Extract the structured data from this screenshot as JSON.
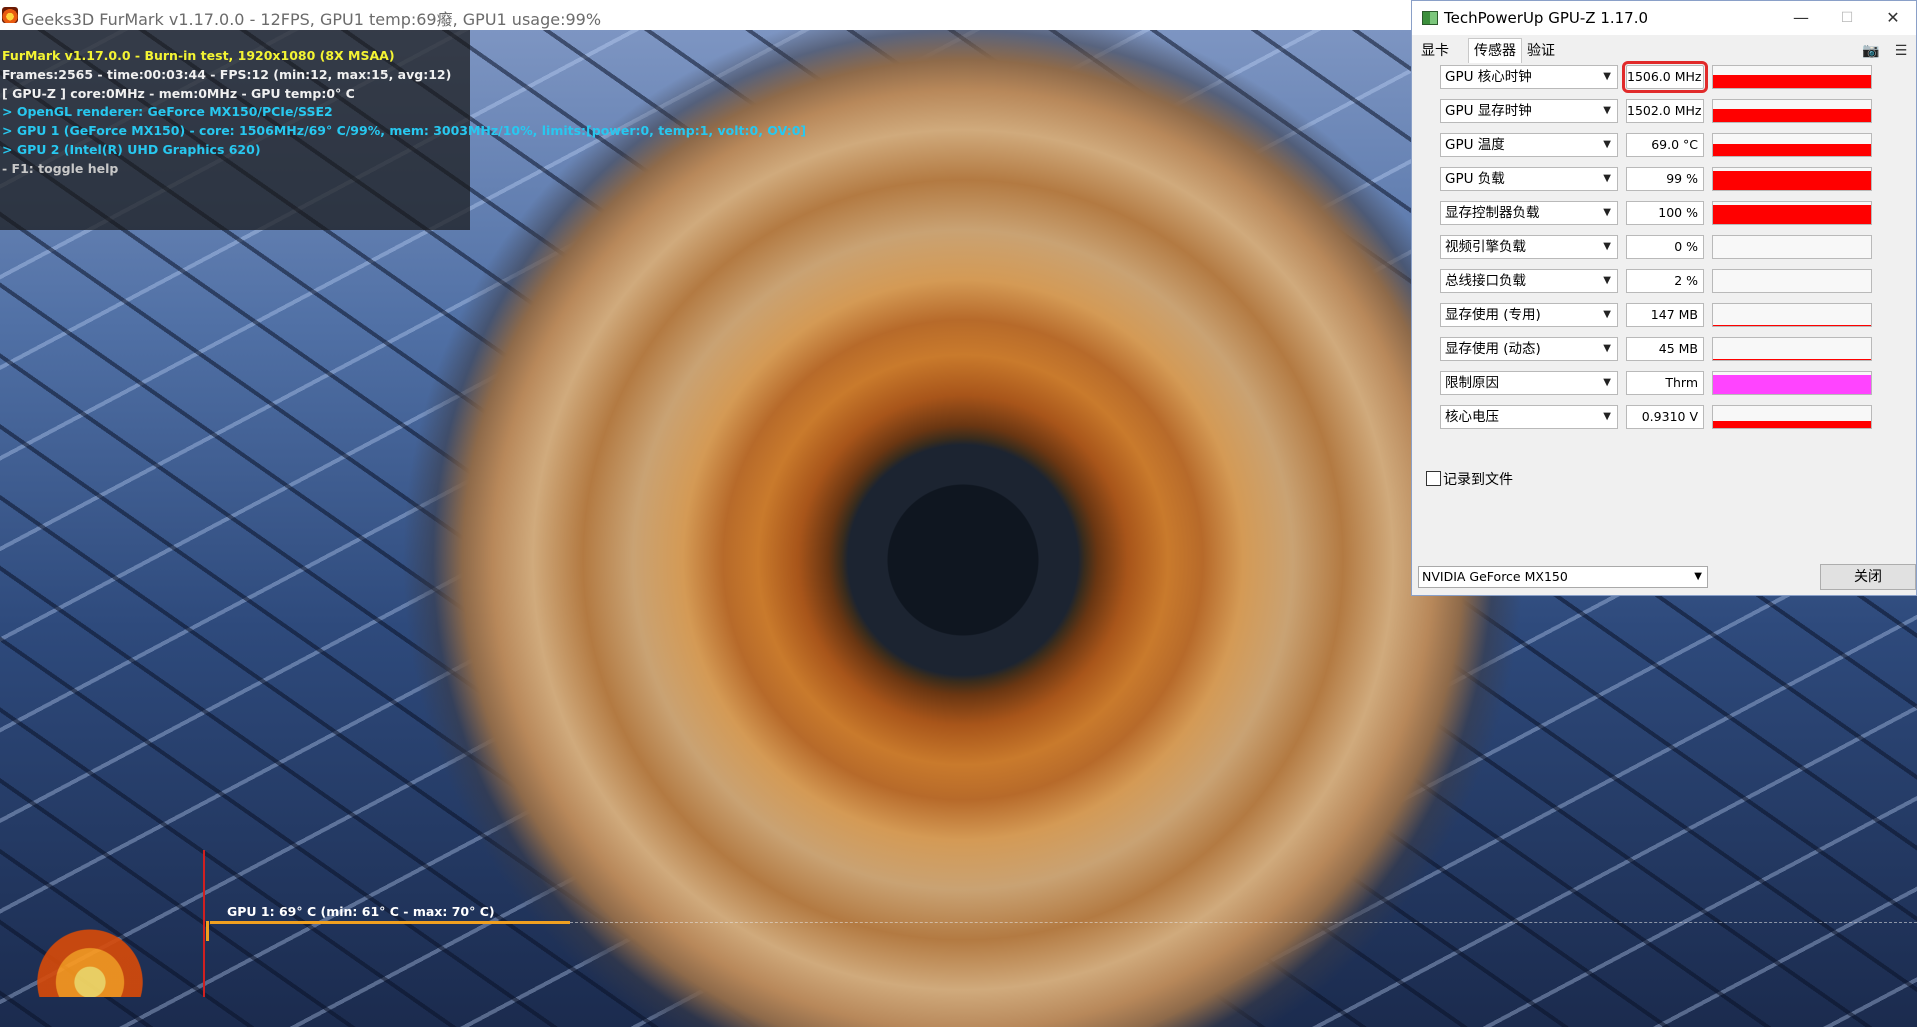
{
  "furmark": {
    "title": "Geeks3D FurMark v1.17.0.0 - 12FPS, GPU1 temp:69癈, GPU1 usage:99%",
    "hud": [
      {
        "text": "FurMark v1.17.0.0 - Burn-in test, 1920x1080 (8X MSAA)",
        "color": "yellow"
      },
      {
        "text": "Frames:2565 - time:00:03:44 - FPS:12 (min:12, max:15, avg:12)",
        "color": "white"
      },
      {
        "text": "[ GPU-Z ] core:0MHz - mem:0MHz - GPU temp:0° C",
        "color": "white"
      },
      {
        "text": "> OpenGL renderer: GeForce MX150/PCIe/SSE2",
        "color": "cyan"
      },
      {
        "text": "> GPU 1 (GeForce MX150) - core: 1506MHz/69° C/99%, mem: 3003MHz/10%, limits:[power:0, temp:1, volt:0, OV:0]",
        "color": "cyan"
      },
      {
        "text": "> GPU 2 (Intel(R) UHD Graphics 620)",
        "color": "cyan"
      },
      {
        "text": "- F1: toggle help",
        "color": "gray"
      }
    ],
    "temp_graph_label": "GPU 1: 69° C (min: 61° C - max: 70° C)"
  },
  "gpuz": {
    "title": "TechPowerUp GPU-Z 1.17.0",
    "window_controls": {
      "minimize": "—",
      "maximize": "☐",
      "close": "✕"
    },
    "tabs": [
      "显卡",
      "传感器",
      "验证"
    ],
    "active_tab": "传感器",
    "toolbar_icons": [
      "camera-icon",
      "menu-icon"
    ],
    "sensors": [
      {
        "name": "GPU 核心时钟",
        "value": "1506.0 MHz",
        "highlighted": true,
        "graph_level": 0.6
      },
      {
        "name": "GPU 显存时钟",
        "value": "1502.0 MHz",
        "highlighted": false,
        "graph_level": 0.6
      },
      {
        "name": "GPU 温度",
        "value": "69.0 °C",
        "highlighted": false,
        "graph_level": 0.55
      },
      {
        "name": "GPU 负载",
        "value": "99 %",
        "highlighted": false,
        "graph_level": 0.85
      },
      {
        "name": "显存控制器负载",
        "value": "100 %",
        "highlighted": false,
        "graph_level": 0.85
      },
      {
        "name": "视频引擎负载",
        "value": "0 %",
        "highlighted": false,
        "graph_level": 0
      },
      {
        "name": "总线接口负载",
        "value": "2 %",
        "highlighted": false,
        "graph_level": 0
      },
      {
        "name": "显存使用 (专用)",
        "value": "147 MB",
        "highlighted": false,
        "graph_level": 0.05
      },
      {
        "name": "显存使用 (动态)",
        "value": "45 MB",
        "highlighted": false,
        "graph_level": 0.05
      },
      {
        "name": "限制原因",
        "value": "Thrm",
        "highlighted": false,
        "graph_level": 0.85,
        "graph_color": "#ff44ff"
      },
      {
        "name": "核心电压",
        "value": "0.9310 V",
        "highlighted": false,
        "graph_level": 0.3
      }
    ],
    "log_to_file_label": "记录到文件",
    "log_to_file_checked": false,
    "device_select": "NVIDIA GeForce MX150",
    "close_button": "关闭"
  },
  "colors": {
    "hud_yellow": "#f4f433",
    "hud_cyan": "#28c8f0",
    "graph_red": "#ff0000",
    "graph_magenta": "#ff44ff",
    "highlight_red": "#e12a2a"
  }
}
